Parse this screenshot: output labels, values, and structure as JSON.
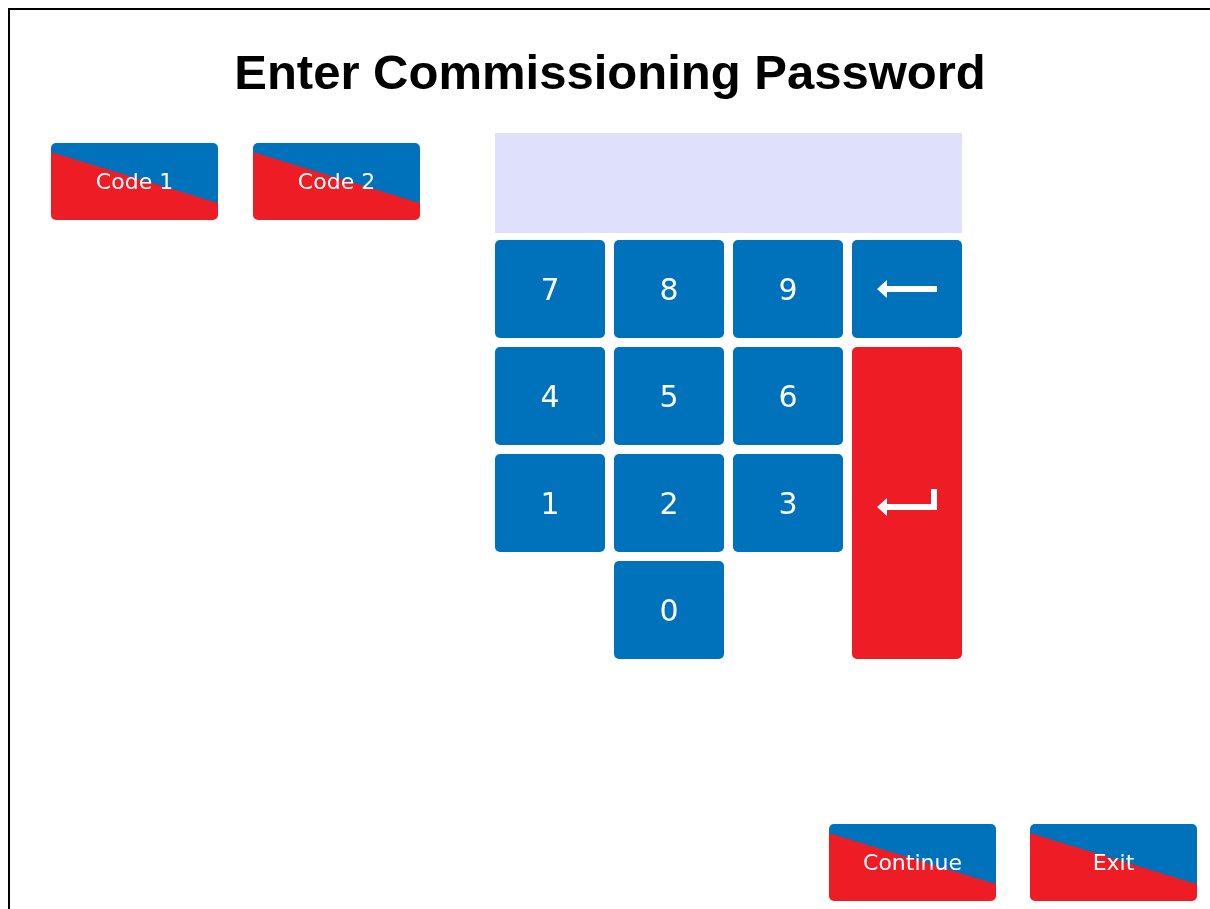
{
  "title": "Enter Commissioning Password",
  "code_buttons": [
    "Code 1",
    "Code 2"
  ],
  "keypad": [
    {
      "kind": "digit",
      "label": "7"
    },
    {
      "kind": "digit",
      "label": "8"
    },
    {
      "kind": "digit",
      "label": "9"
    },
    {
      "kind": "backspace"
    },
    {
      "kind": "digit",
      "label": "4"
    },
    {
      "kind": "digit",
      "label": "5"
    },
    {
      "kind": "digit",
      "label": "6"
    },
    {
      "kind": "enter"
    },
    {
      "kind": "digit",
      "label": "1"
    },
    {
      "kind": "digit",
      "label": "2"
    },
    {
      "kind": "digit",
      "label": "3"
    },
    {
      "kind": "digit",
      "label": "0"
    }
  ],
  "bottom_buttons": [
    "Continue",
    "Exit"
  ]
}
